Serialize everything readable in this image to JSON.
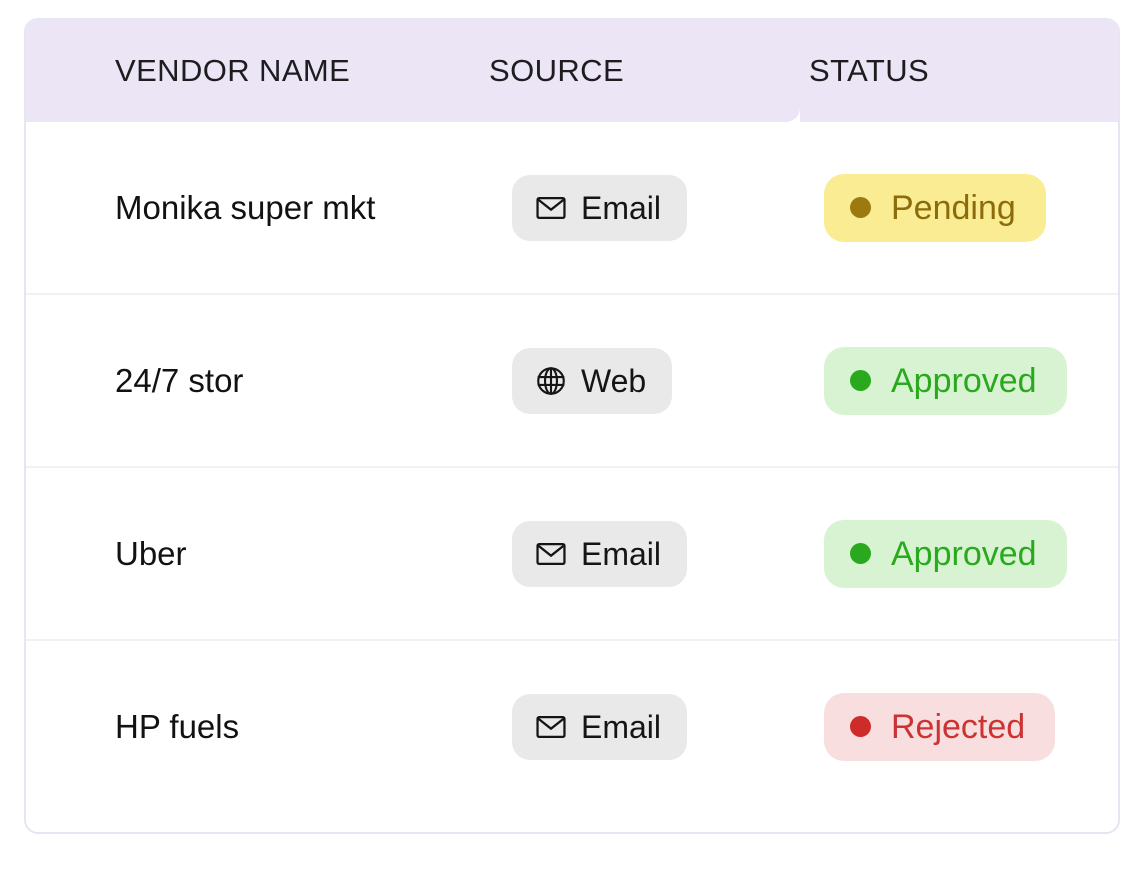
{
  "table": {
    "columns": [
      {
        "key": "vendor_name",
        "label": "VENDOR NAME"
      },
      {
        "key": "source",
        "label": "SOURCE"
      },
      {
        "key": "status",
        "label": "STATUS"
      }
    ],
    "header_background": "#EBE5F5",
    "border_color": "#E8E5F2",
    "row_divider_color": "#F1F1F3",
    "rows": [
      {
        "vendor_name": "Monika super mkt",
        "source": {
          "label": "Email",
          "icon": "envelope-icon"
        },
        "status": {
          "label": "Pending",
          "kind": "pending",
          "background": "#FAEC92",
          "text_color": "#8C6C0A",
          "dot_color": "#9C7A10"
        }
      },
      {
        "vendor_name": "24/7 stor",
        "source": {
          "label": "Web",
          "icon": "globe-icon"
        },
        "status": {
          "label": "Approved",
          "kind": "approved",
          "background": "#D8F3D2",
          "text_color": "#2BA91E",
          "dot_color": "#2BA91E"
        }
      },
      {
        "vendor_name": "Uber",
        "source": {
          "label": "Email",
          "icon": "envelope-icon"
        },
        "status": {
          "label": "Approved",
          "kind": "approved",
          "background": "#D8F3D2",
          "text_color": "#2BA91E",
          "dot_color": "#2BA91E"
        }
      },
      {
        "vendor_name": "HP fuels",
        "source": {
          "label": "Email",
          "icon": "envelope-icon"
        },
        "status": {
          "label": "Rejected",
          "kind": "rejected",
          "background": "#F8DEDE",
          "text_color": "#CC3333",
          "dot_color": "#CE2B2B"
        }
      }
    ]
  }
}
